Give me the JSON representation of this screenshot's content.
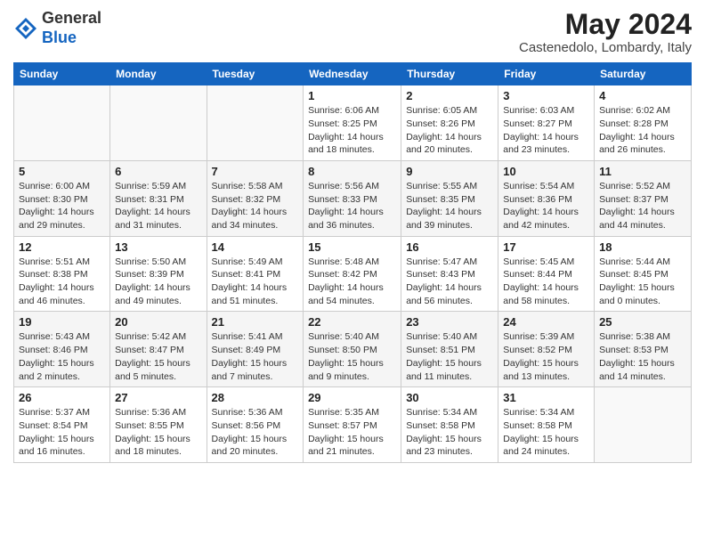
{
  "header": {
    "logo_general": "General",
    "logo_blue": "Blue",
    "month_year": "May 2024",
    "location": "Castenedolo, Lombardy, Italy"
  },
  "days_of_week": [
    "Sunday",
    "Monday",
    "Tuesday",
    "Wednesday",
    "Thursday",
    "Friday",
    "Saturday"
  ],
  "weeks": [
    [
      {
        "day": "",
        "info": ""
      },
      {
        "day": "",
        "info": ""
      },
      {
        "day": "",
        "info": ""
      },
      {
        "day": "1",
        "info": "Sunrise: 6:06 AM\nSunset: 8:25 PM\nDaylight: 14 hours\nand 18 minutes."
      },
      {
        "day": "2",
        "info": "Sunrise: 6:05 AM\nSunset: 8:26 PM\nDaylight: 14 hours\nand 20 minutes."
      },
      {
        "day": "3",
        "info": "Sunrise: 6:03 AM\nSunset: 8:27 PM\nDaylight: 14 hours\nand 23 minutes."
      },
      {
        "day": "4",
        "info": "Sunrise: 6:02 AM\nSunset: 8:28 PM\nDaylight: 14 hours\nand 26 minutes."
      }
    ],
    [
      {
        "day": "5",
        "info": "Sunrise: 6:00 AM\nSunset: 8:30 PM\nDaylight: 14 hours\nand 29 minutes."
      },
      {
        "day": "6",
        "info": "Sunrise: 5:59 AM\nSunset: 8:31 PM\nDaylight: 14 hours\nand 31 minutes."
      },
      {
        "day": "7",
        "info": "Sunrise: 5:58 AM\nSunset: 8:32 PM\nDaylight: 14 hours\nand 34 minutes."
      },
      {
        "day": "8",
        "info": "Sunrise: 5:56 AM\nSunset: 8:33 PM\nDaylight: 14 hours\nand 36 minutes."
      },
      {
        "day": "9",
        "info": "Sunrise: 5:55 AM\nSunset: 8:35 PM\nDaylight: 14 hours\nand 39 minutes."
      },
      {
        "day": "10",
        "info": "Sunrise: 5:54 AM\nSunset: 8:36 PM\nDaylight: 14 hours\nand 42 minutes."
      },
      {
        "day": "11",
        "info": "Sunrise: 5:52 AM\nSunset: 8:37 PM\nDaylight: 14 hours\nand 44 minutes."
      }
    ],
    [
      {
        "day": "12",
        "info": "Sunrise: 5:51 AM\nSunset: 8:38 PM\nDaylight: 14 hours\nand 46 minutes."
      },
      {
        "day": "13",
        "info": "Sunrise: 5:50 AM\nSunset: 8:39 PM\nDaylight: 14 hours\nand 49 minutes."
      },
      {
        "day": "14",
        "info": "Sunrise: 5:49 AM\nSunset: 8:41 PM\nDaylight: 14 hours\nand 51 minutes."
      },
      {
        "day": "15",
        "info": "Sunrise: 5:48 AM\nSunset: 8:42 PM\nDaylight: 14 hours\nand 54 minutes."
      },
      {
        "day": "16",
        "info": "Sunrise: 5:47 AM\nSunset: 8:43 PM\nDaylight: 14 hours\nand 56 minutes."
      },
      {
        "day": "17",
        "info": "Sunrise: 5:45 AM\nSunset: 8:44 PM\nDaylight: 14 hours\nand 58 minutes."
      },
      {
        "day": "18",
        "info": "Sunrise: 5:44 AM\nSunset: 8:45 PM\nDaylight: 15 hours\nand 0 minutes."
      }
    ],
    [
      {
        "day": "19",
        "info": "Sunrise: 5:43 AM\nSunset: 8:46 PM\nDaylight: 15 hours\nand 2 minutes."
      },
      {
        "day": "20",
        "info": "Sunrise: 5:42 AM\nSunset: 8:47 PM\nDaylight: 15 hours\nand 5 minutes."
      },
      {
        "day": "21",
        "info": "Sunrise: 5:41 AM\nSunset: 8:49 PM\nDaylight: 15 hours\nand 7 minutes."
      },
      {
        "day": "22",
        "info": "Sunrise: 5:40 AM\nSunset: 8:50 PM\nDaylight: 15 hours\nand 9 minutes."
      },
      {
        "day": "23",
        "info": "Sunrise: 5:40 AM\nSunset: 8:51 PM\nDaylight: 15 hours\nand 11 minutes."
      },
      {
        "day": "24",
        "info": "Sunrise: 5:39 AM\nSunset: 8:52 PM\nDaylight: 15 hours\nand 13 minutes."
      },
      {
        "day": "25",
        "info": "Sunrise: 5:38 AM\nSunset: 8:53 PM\nDaylight: 15 hours\nand 14 minutes."
      }
    ],
    [
      {
        "day": "26",
        "info": "Sunrise: 5:37 AM\nSunset: 8:54 PM\nDaylight: 15 hours\nand 16 minutes."
      },
      {
        "day": "27",
        "info": "Sunrise: 5:36 AM\nSunset: 8:55 PM\nDaylight: 15 hours\nand 18 minutes."
      },
      {
        "day": "28",
        "info": "Sunrise: 5:36 AM\nSunset: 8:56 PM\nDaylight: 15 hours\nand 20 minutes."
      },
      {
        "day": "29",
        "info": "Sunrise: 5:35 AM\nSunset: 8:57 PM\nDaylight: 15 hours\nand 21 minutes."
      },
      {
        "day": "30",
        "info": "Sunrise: 5:34 AM\nSunset: 8:58 PM\nDaylight: 15 hours\nand 23 minutes."
      },
      {
        "day": "31",
        "info": "Sunrise: 5:34 AM\nSunset: 8:58 PM\nDaylight: 15 hours\nand 24 minutes."
      },
      {
        "day": "",
        "info": ""
      }
    ]
  ]
}
